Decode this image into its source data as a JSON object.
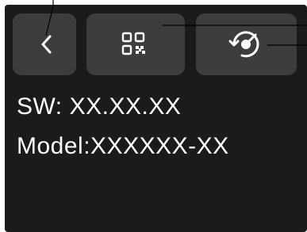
{
  "toolbar": {
    "back_button": {
      "icon": "chevron-left-icon"
    },
    "qr_button": {
      "icon": "qr-code-icon"
    },
    "reset_button": {
      "icon": "calibrate-reset-icon"
    }
  },
  "info": {
    "sw_label": "SW:",
    "sw_value": "XX.XX.XX",
    "model_label": "Model:",
    "model_value": "XXXXXX-XX"
  },
  "colors": {
    "screen_background": "#1c1b1b",
    "button_background": "#3d3d3d",
    "text": "#ffffff",
    "callout_line": "#000000"
  }
}
